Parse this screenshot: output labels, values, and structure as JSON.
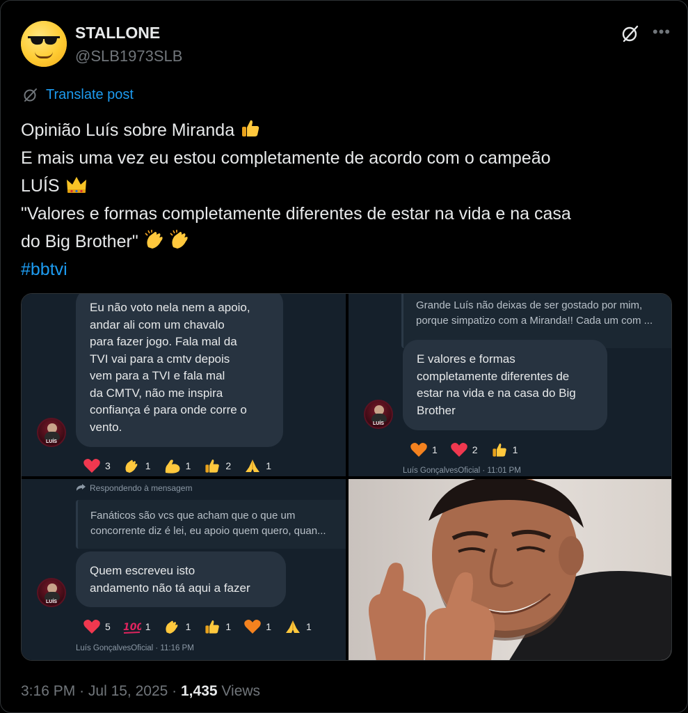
{
  "author": {
    "display_name": "STALLONE",
    "handle": "@SLB1973SLB",
    "avatar_icon": "smiling-face-with-sunglasses-icon"
  },
  "translate_label": "Translate post",
  "post": {
    "line1": "Opinião Luís sobre Miranda",
    "line2": "E mais uma vez eu estou completamente de acordo com o campeão",
    "line3": "LUÍS",
    "line4": "\"Valores e formas completamente diferentes de estar na vida e na casa",
    "line5": "do Big Brother\"",
    "hashtag": "#bbtvi"
  },
  "media": {
    "panel1": {
      "avatar_label": "LUÍS",
      "message_lines": [
        "Eu não voto nela nem a apoio,",
        "andar ali com um chavalo",
        "para fazer jogo. Fala mal da",
        "TVI vai para a cmtv depois",
        "vem para a TVI e fala mal",
        "da CMTV, não me inspira",
        "confiança é para onde corre o",
        "vento."
      ],
      "reactions": [
        {
          "icon": "red-heart-icon",
          "count": "3"
        },
        {
          "icon": "clapping-hands-icon",
          "count": "1"
        },
        {
          "icon": "flexed-biceps-icon",
          "count": "1"
        },
        {
          "icon": "thumbs-up-icon",
          "count": "2"
        },
        {
          "icon": "folded-hands-icon",
          "count": "1"
        }
      ]
    },
    "panel2": {
      "avatar_label": "LUÍS",
      "quoted_lines": [
        "Grande Luís não deixas de ser gostado por mim,",
        "porque simpatizo com a Miranda!! Cada um com ..."
      ],
      "message_lines": [
        "E valores e formas",
        "completamente diferentes de",
        "estar na vida e na casa do Big",
        "Brother"
      ],
      "reactions": [
        {
          "icon": "orange-heart-icon",
          "count": "1"
        },
        {
          "icon": "red-heart-icon",
          "count": "2"
        },
        {
          "icon": "thumbs-up-icon",
          "count": "1"
        }
      ],
      "meta": "Luís GonçalvesOficial · 11:01 PM"
    },
    "panel3": {
      "avatar_label": "LUÍS",
      "reply_label": "Respondendo à mensagem",
      "quoted_lines": [
        "Fanáticos são vcs que acham que o que um",
        "concorrente diz é lei, eu apoio quem quero, quan..."
      ],
      "message_lines": [
        "Quem escreveu isto",
        "andamento não tá aqui a fazer"
      ],
      "reactions": [
        {
          "icon": "red-heart-icon",
          "count": "5"
        },
        {
          "icon": "hundred-points-icon",
          "count": "1"
        },
        {
          "icon": "clapping-hands-icon",
          "count": "1"
        },
        {
          "icon": "thumbs-up-icon",
          "count": "1"
        },
        {
          "icon": "orange-heart-icon",
          "count": "1"
        },
        {
          "icon": "folded-hands-icon",
          "count": "1"
        }
      ],
      "meta": "Luís GonçalvesOficial · 11:16 PM"
    },
    "panel4": {
      "image_icon": "man-thumbs-up-photo"
    }
  },
  "footer": {
    "time": "3:16 PM",
    "date": "Jul 15, 2025",
    "views_count": "1,435",
    "views_label": "Views"
  },
  "colors": {
    "background": "#000000",
    "text": "#e7e9ea",
    "secondary": "#71767b",
    "link": "#1d9bf0",
    "bubble": "#273340",
    "chat_bg": "#15202b"
  }
}
